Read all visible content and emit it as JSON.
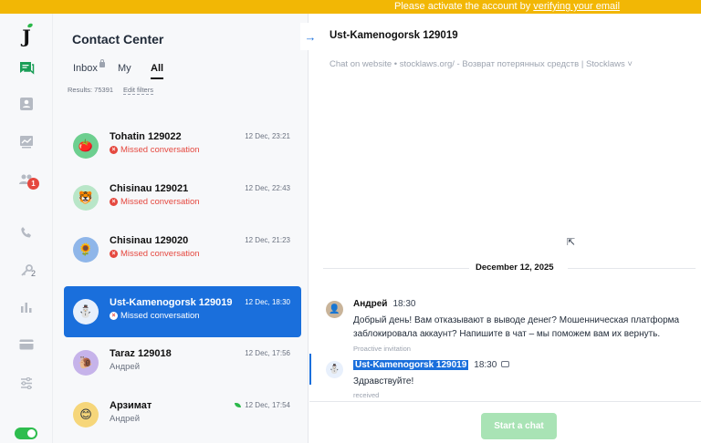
{
  "banner": {
    "text": "Please activate the account by ",
    "link": "verifying your email"
  },
  "rail": {
    "logo": "J",
    "badge": "1",
    "sub": "2",
    "icons": [
      "chat-icon",
      "contact-card-icon",
      "chart-icon",
      "team-icon",
      "phone-icon",
      "key-icon",
      "bar-chart-icon",
      "card-icon",
      "sliders-icon"
    ]
  },
  "list": {
    "title": "Contact Center",
    "tabs": [
      "Inbox",
      "My",
      "All"
    ],
    "results": "Results: 75391",
    "edit_filters": "Edit filters",
    "items": [
      {
        "name": "Tohatin 129022",
        "date": "12 Dec, 23:21",
        "status": "Missed conversation",
        "avatar": "🍅",
        "color": "#6dcf8f"
      },
      {
        "name": "Chisinau 129021",
        "date": "12 Dec, 22:43",
        "status": "Missed conversation",
        "avatar": "🐯",
        "color": "#b9e6c8"
      },
      {
        "name": "Chisinau 129020",
        "date": "12 Dec, 21:23",
        "status": "Missed conversation",
        "avatar": "🌻",
        "color": "#8fb6e9"
      },
      {
        "name": "Ust-Kamenogorsk 129019",
        "date": "12 Dec, 18:30",
        "status": "Missed conversation",
        "avatar": "⛄",
        "color": "#e8f0fc"
      },
      {
        "name": "Taraz 129018",
        "date": "12 Dec, 17:56",
        "status": "Андрей",
        "avatar": "🐌",
        "color": "#c6b3ea"
      },
      {
        "name": "Арзимат",
        "date": "12 Dec, 17:54",
        "status": "Андрей",
        "avatar": "😊",
        "color": "#f6d67a"
      }
    ]
  },
  "chat": {
    "title": "Ust-Kamenogorsk 129019",
    "source": "Chat on website • stocklaws.org/ - Возврат потерянных средств | Stocklaws ˅",
    "date_separator": "December 12, 2025",
    "messages": [
      {
        "author": "Андрей",
        "time": "18:30",
        "text": "Добрый день! Вам отказывают в выводе денег? Мошенническая платформа заблокировала аккаунт? Напишите в чат – мы поможем вам их вернуть.",
        "meta": "Proactive invitation"
      },
      {
        "author": "Ust-Kamenogorsk 129019",
        "time": "18:30",
        "text": "Здравствуйте!",
        "meta": "received"
      }
    ],
    "start_button": "Start a chat"
  },
  "colors": {
    "accent": "#1a6fdc",
    "banner": "#f2b705",
    "missed": "#e5483f",
    "online": "#2ebd4e"
  }
}
